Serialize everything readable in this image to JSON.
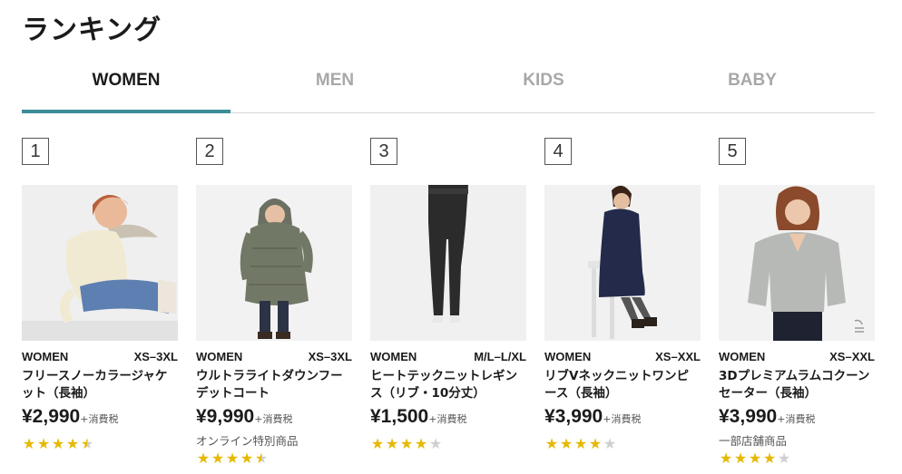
{
  "page": {
    "title": "ランキング"
  },
  "tabs": [
    {
      "label": "WOMEN",
      "active": true
    },
    {
      "label": "MEN",
      "active": false
    },
    {
      "label": "KIDS",
      "active": false
    },
    {
      "label": "BABY",
      "active": false
    }
  ],
  "colors": {
    "accent": "#3b8c99",
    "star": "#e6b800",
    "star_empty": "#cfcfcf"
  },
  "products": [
    {
      "rank": "1",
      "category": "WOMEN",
      "size": "XS–3XL",
      "name": "フリースノーカラージャケット（長袖）",
      "price": "¥2,990",
      "tax": "+消費税",
      "note": "",
      "rating": 4.5,
      "image": "woman-in-cream-fleece-jacket"
    },
    {
      "rank": "2",
      "category": "WOMEN",
      "size": "XS–3XL",
      "name": "ウルトラライトダウンフーデットコート",
      "price": "¥9,990",
      "tax": "+消費税",
      "note": "オンライン特別商品",
      "rating": 4.5,
      "image": "woman-in-olive-down-coat"
    },
    {
      "rank": "3",
      "category": "WOMEN",
      "size": "M/L–L/XL",
      "name": "ヒートテックニットレギンス（リブ・10分丈）",
      "price": "¥1,500",
      "tax": "+消費税",
      "note": "",
      "rating": 4,
      "image": "black-knit-leggings"
    },
    {
      "rank": "4",
      "category": "WOMEN",
      "size": "XS–XXL",
      "name": "リブVネックニットワンピース（長袖）",
      "price": "¥3,990",
      "tax": "+消費税",
      "note": "",
      "rating": 4,
      "image": "woman-in-navy-knit-dress"
    },
    {
      "rank": "5",
      "category": "WOMEN",
      "size": "XS–XXL",
      "name": "3Dプレミアムラムコクーンセーター（長袖）",
      "price": "¥3,990",
      "tax": "+消費税",
      "note": "一部店舗商品",
      "rating": 4,
      "image": "woman-in-gray-sweater"
    }
  ]
}
